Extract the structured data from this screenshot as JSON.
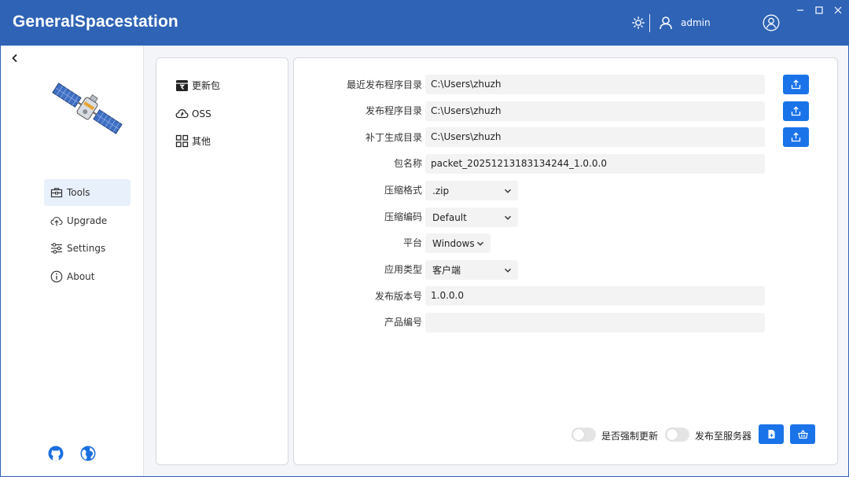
{
  "header": {
    "title": "GeneralSpacestation",
    "username": "admin"
  },
  "icons": {
    "theme": "sun-icon",
    "user": "user-icon",
    "account": "account-circle-icon",
    "back": "chevron-left-icon",
    "github": "github-icon",
    "web": "globe-icon"
  },
  "colors": {
    "header_bg": "#2e63b6",
    "accent": "#1a73e8",
    "nav_active_bg": "#e8f0fb",
    "field_bg": "#f3f3f3"
  },
  "sidebar": {
    "items": [
      {
        "label": "Tools",
        "icon": "toolbox-icon",
        "active": true
      },
      {
        "label": "Upgrade",
        "icon": "cloud-upload-icon",
        "active": false
      },
      {
        "label": "Settings",
        "icon": "sliders-icon",
        "active": false
      },
      {
        "label": "About",
        "icon": "info-icon",
        "active": false
      }
    ]
  },
  "subnav": {
    "items": [
      {
        "label": "更新包",
        "icon": "package-icon"
      },
      {
        "label": "OSS",
        "icon": "cloud-icon"
      },
      {
        "label": "其他",
        "icon": "grid-icon"
      }
    ]
  },
  "form": {
    "recent_dir": {
      "label": "最近发布程序目录",
      "value": "C:\\Users\\zhuzh"
    },
    "publish_dir": {
      "label": "发布程序目录",
      "value": "C:\\Users\\zhuzh"
    },
    "patch_dir": {
      "label": "补丁生成目录",
      "value": "C:\\Users\\zhuzh"
    },
    "package_name": {
      "label": "包名称",
      "value": "packet_20251213183134244_1.0.0.0"
    },
    "compress_format": {
      "label": "压缩格式",
      "value": ".zip"
    },
    "compress_encoding": {
      "label": "压缩编码",
      "value": "Default"
    },
    "platform": {
      "label": "平台",
      "value": "Windows"
    },
    "app_type": {
      "label": "应用类型",
      "value": "客户端"
    },
    "version": {
      "label": "发布版本号",
      "value": "1.0.0.0"
    },
    "product_code": {
      "label": "产品编号",
      "value": ""
    }
  },
  "footer": {
    "force_update": {
      "label": "是否强制更新",
      "on": false
    },
    "publish_server": {
      "label": "发布至服务器",
      "on": false
    },
    "buttons": [
      "file-generate-icon",
      "basket-icon"
    ]
  }
}
